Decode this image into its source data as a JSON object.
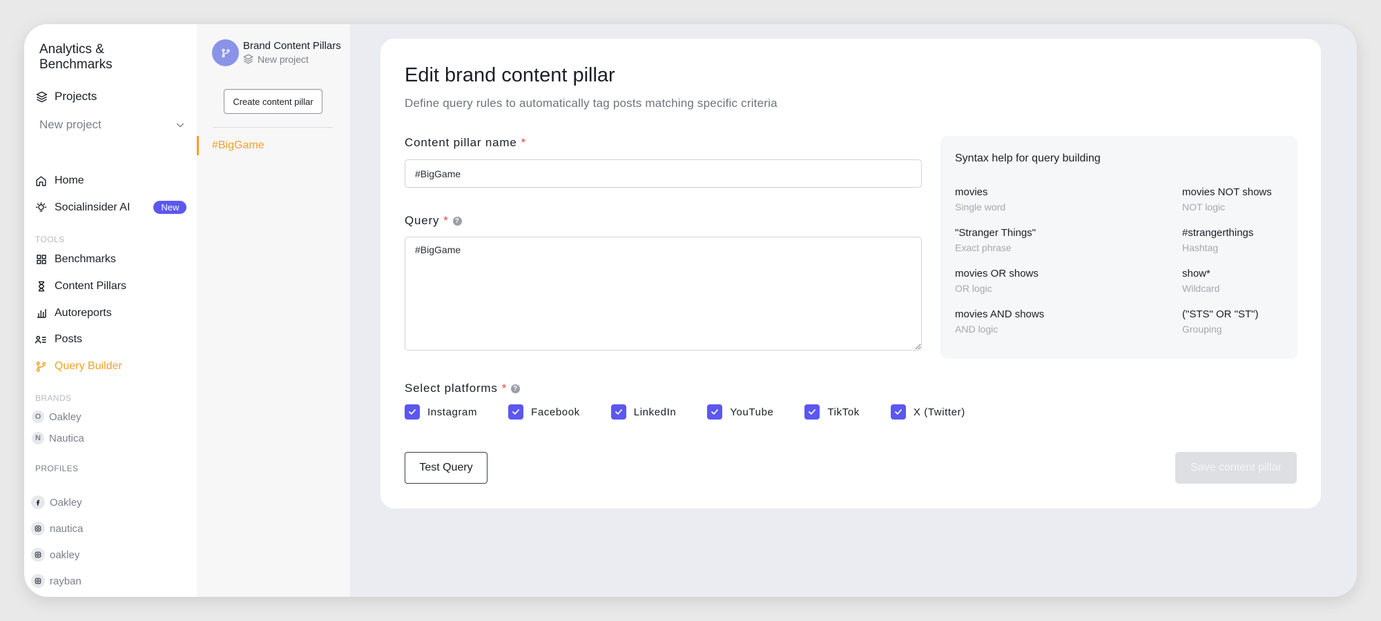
{
  "sidebar": {
    "app_title": "Analytics & Benchmarks",
    "projects_label": "Projects",
    "project_select": "New project",
    "nav": [
      {
        "label": "Home",
        "icon": "home-icon"
      },
      {
        "label": "Socialinsider AI",
        "icon": "lightbulb-icon",
        "badge": "New"
      },
      {
        "label": "Benchmarks",
        "icon": "grid-icon"
      },
      {
        "label": "Content Pillars",
        "icon": "hourglass-icon"
      },
      {
        "label": "Autoreports",
        "icon": "bar-chart-icon"
      },
      {
        "label": "Posts",
        "icon": "posts-list-icon"
      },
      {
        "label": "Query Builder",
        "icon": "git-branch-icon",
        "active": true
      }
    ],
    "tools_label": "TOOLS",
    "brands_label": "BRANDS",
    "brands": [
      {
        "initial": "O",
        "name": "Oakley"
      },
      {
        "initial": "N",
        "name": "Nautica"
      }
    ],
    "profiles_label": "PROFILES",
    "profiles": [
      {
        "name": "Oakley",
        "icon": "facebook-icon"
      },
      {
        "name": "nautica",
        "icon": "instagram-icon"
      },
      {
        "name": "oakley",
        "icon": "instagram-icon"
      },
      {
        "name": "rayban",
        "icon": "instagram-icon"
      }
    ]
  },
  "pillars_panel": {
    "title": "Brand Content Pillars",
    "subtitle": "New project",
    "create_button": "Create content pillar",
    "items": [
      "#BigGame"
    ]
  },
  "main": {
    "title": "Edit brand content pillar",
    "subtitle": "Define query rules to automatically tag posts matching specific criteria",
    "name_label": "Content pillar name",
    "name_value": "#BigGame",
    "query_label": "Query",
    "query_value": "#BigGame",
    "required_mark": "*",
    "help_glyph": "?",
    "platforms_label": "Select platforms",
    "platforms": [
      "Instagram",
      "Facebook",
      "LinkedIn",
      "YouTube",
      "TikTok",
      "X (Twitter)"
    ],
    "test_button": "Test Query",
    "save_button": "Save content pillar"
  },
  "syntax_help": {
    "title": "Syntax help for query building",
    "items": [
      {
        "keyword": "movies",
        "desc": "Single word"
      },
      {
        "keyword": "movies NOT shows",
        "desc": "NOT logic"
      },
      {
        "keyword": "\"Stranger Things\"",
        "desc": "Exact phrase"
      },
      {
        "keyword": "#strangerthings",
        "desc": "Hashtag"
      },
      {
        "keyword": "movies OR shows",
        "desc": "OR logic"
      },
      {
        "keyword": "show*",
        "desc": "Wildcard"
      },
      {
        "keyword": "movies AND shows",
        "desc": "AND logic"
      },
      {
        "keyword": "(\"STS\" OR \"ST\")",
        "desc": "Grouping"
      }
    ]
  },
  "colors": {
    "accent": "#f3a12a",
    "primary": "#5b57f0",
    "required": "#e0473e"
  }
}
